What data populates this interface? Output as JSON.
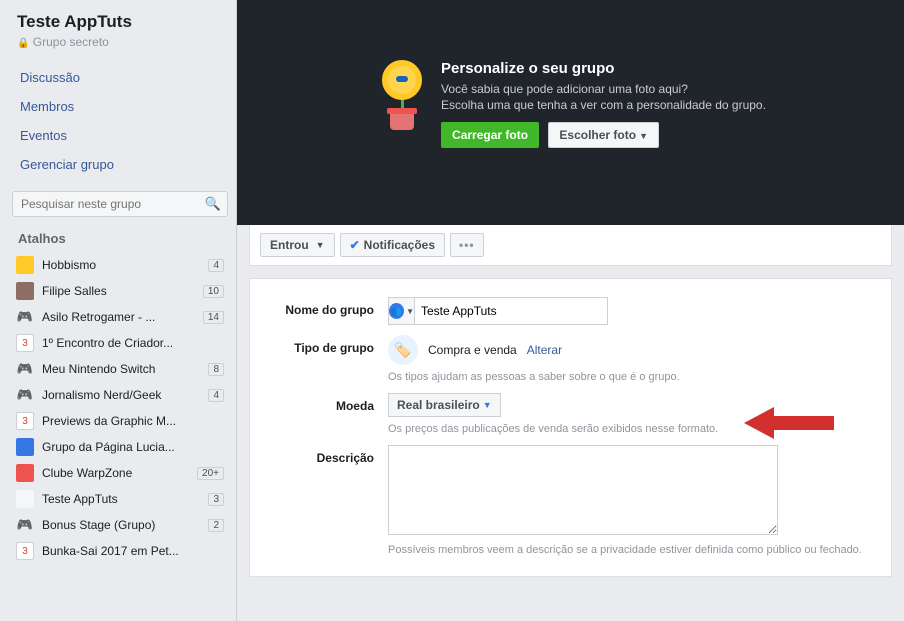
{
  "sidebar": {
    "group_title": "Teste AppTuts",
    "privacy": "Grupo secreto",
    "nav": [
      "Discussão",
      "Membros",
      "Eventos",
      "Gerenciar grupo"
    ],
    "search_placeholder": "Pesquisar neste grupo",
    "shortcuts_header": "Atalhos",
    "shortcuts": [
      {
        "label": "Hobbismo",
        "badge": "4",
        "color": "#ffca28"
      },
      {
        "label": "Filipe Salles",
        "badge": "10",
        "color": "#8d6e63"
      },
      {
        "label": "Asilo Retrogamer - ...",
        "badge": "14",
        "color": "#616161"
      },
      {
        "label": "1º Encontro de Criador...",
        "badge": "",
        "color": "#fff",
        "num": "3"
      },
      {
        "label": "Meu Nintendo Switch",
        "badge": "8",
        "color": "#616161"
      },
      {
        "label": "Jornalismo Nerd/Geek",
        "badge": "4",
        "color": "#616161"
      },
      {
        "label": "Previews da Graphic M...",
        "badge": "",
        "color": "#fff",
        "num": "3"
      },
      {
        "label": "Grupo da Página Lucia...",
        "badge": "",
        "color": "#3578e5"
      },
      {
        "label": "Clube WarpZone",
        "badge": "20+",
        "color": "#ef5350"
      },
      {
        "label": "Teste AppTuts",
        "badge": "3",
        "color": "#f5f6f7"
      },
      {
        "label": "Bonus Stage (Grupo)",
        "badge": "2",
        "color": "#616161"
      },
      {
        "label": "Bunka-Sai 2017 em Pet...",
        "badge": "",
        "color": "#fff",
        "num": "3"
      }
    ]
  },
  "cover": {
    "title": "Personalize o seu grupo",
    "line1": "Você sabia que pode adicionar uma foto aqui?",
    "line2": "Escolha uma que tenha a ver com a personalidade do grupo.",
    "btn_upload": "Carregar foto",
    "btn_choose": "Escolher foto"
  },
  "toolbar": {
    "joined": "Entrou",
    "notifications": "Notificações",
    "more": "•••"
  },
  "form": {
    "name_label": "Nome do grupo",
    "name_value": "Teste AppTuts",
    "type_label": "Tipo de grupo",
    "type_value": "Compra e venda",
    "type_change": "Alterar",
    "type_helper": "Os tipos ajudam as pessoas a saber sobre o que é o grupo.",
    "currency_label": "Moeda",
    "currency_value": "Real brasileiro",
    "currency_helper": "Os preços das publicações de venda serão exibidos nesse formato.",
    "desc_label": "Descrição",
    "desc_helper": "Possíveis membros veem a descrição se a privacidade estiver definida como público ou fechado."
  }
}
